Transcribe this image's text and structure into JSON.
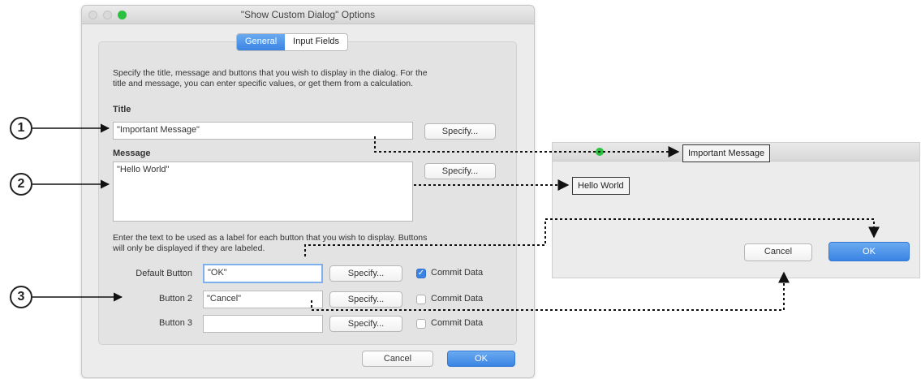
{
  "dialog": {
    "title": "\"Show Custom Dialog\" Options",
    "tabs": [
      {
        "label": "General",
        "active": true
      },
      {
        "label": "Input Fields",
        "active": false
      }
    ],
    "intro_line1": "Specify the title, message and buttons that you wish to display in the dialog. For the",
    "intro_line2": "title and message, you can enter specific values, or get them from a calculation.",
    "title_label": "Title",
    "title_value": "\"Important Message\"",
    "message_label": "Message",
    "message_value": "\"Hello World\"",
    "specify_label": "Specify...",
    "buttons_note_line1": "Enter the text to be used as a label for each button that you wish to display. Buttons",
    "buttons_note_line2": "will only be displayed if they are labeled.",
    "buttons": [
      {
        "label": "Default Button",
        "value": "\"OK\"",
        "commit_label": "Commit Data",
        "commit_checked": true
      },
      {
        "label": "Button 2",
        "value": "\"Cancel\"",
        "commit_label": "Commit Data",
        "commit_checked": false
      },
      {
        "label": "Button 3",
        "value": "",
        "commit_label": "Commit Data",
        "commit_checked": false
      }
    ],
    "cancel_label": "Cancel",
    "ok_label": "OK"
  },
  "preview": {
    "title": "Important Message",
    "message": "Hello World",
    "cancel_label": "Cancel",
    "ok_label": "OK"
  },
  "callouts": [
    "1",
    "2",
    "3"
  ],
  "colors": {
    "accent": "#3a84e3",
    "close": "#d9d9d9",
    "zoom": "#2bc040"
  }
}
